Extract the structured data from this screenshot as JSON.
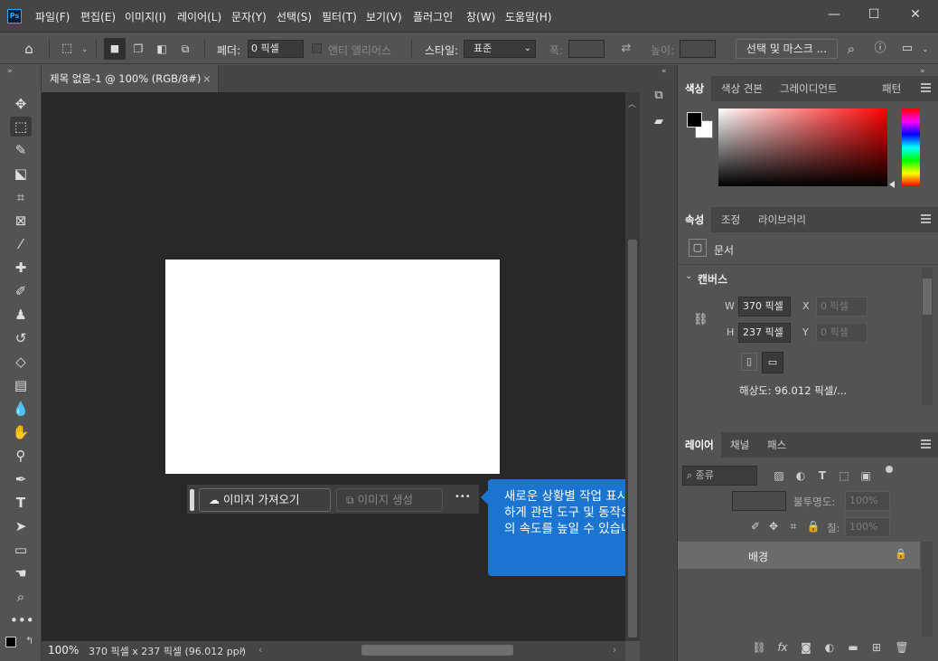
{
  "app": {
    "logo": "Ps"
  },
  "menu": [
    "파일(F)",
    "편집(E)",
    "이미지(I)",
    "레이어(L)",
    "문자(Y)",
    "선택(S)",
    "필터(T)",
    "보기(V)",
    "플러그인",
    "창(W)",
    "도움말(H)"
  ],
  "window_controls": {
    "minimize": "—",
    "maximize": "☐",
    "close": "✕"
  },
  "options": {
    "feather_label": "페더:",
    "feather_value": "0 픽셀",
    "antialias_label": "앤티 앨리어스",
    "style_label": "스타일:",
    "style_value": "표준",
    "width_label": "폭:",
    "height_label": "높이:",
    "select_mask_button": "선택 및 마스크 ..."
  },
  "document": {
    "tab_title": "제목 없음-1 @ 100% (RGB/8#)",
    "close": "×"
  },
  "context_bar": {
    "import_button": "이미지 가져오기",
    "generate_button": "이미지 생성",
    "more": "•••"
  },
  "tooltip": {
    "text": "새로운 상황별 작업 표시줄을 통해 간편하게 관련 도구 및 동작으로 워크플로우의 속도를 높일 수 있습니다."
  },
  "status": {
    "zoom": "100%",
    "info": "370 픽셀 x 237 픽셀 (96.012 ppi)"
  },
  "color_panel": {
    "tabs": [
      "색상",
      "색상 견본",
      "그레이디언트",
      "패턴"
    ],
    "foreground": "#000000",
    "background": "#ffffff",
    "hue": "#ff0000"
  },
  "properties_panel": {
    "tabs": [
      "속성",
      "조정",
      "라이브러리"
    ],
    "doc_label": "문서",
    "section": "캔버스",
    "w_label": "W",
    "w_value": "370 픽셀",
    "h_label": "H",
    "h_value": "237 픽셀",
    "x_label": "X",
    "x_placeholder": "0 픽셀",
    "y_label": "Y",
    "y_placeholder": "0 픽셀",
    "resolution": "해상도: 96.012 픽셀/..."
  },
  "layers_panel": {
    "tabs": [
      "레이어",
      "채널",
      "패스"
    ],
    "filter_label": "종류",
    "opacity_label": "불투명도:",
    "opacity_value": "100%",
    "lock_label": "칠:",
    "fill_value": "100%",
    "layer_name": "배경"
  }
}
